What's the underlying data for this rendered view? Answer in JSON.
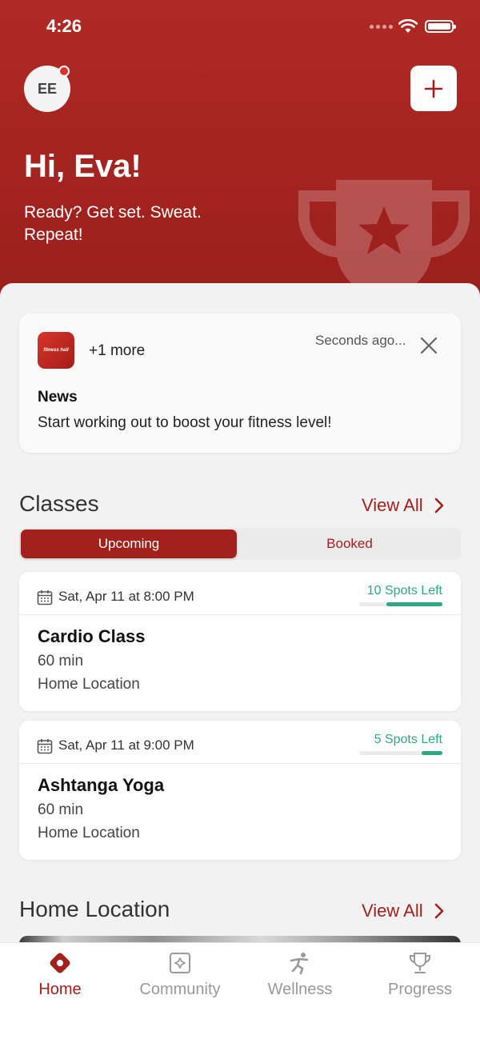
{
  "status_bar": {
    "time": "4:26"
  },
  "header": {
    "avatar_initials": "EE",
    "greeting": "Hi, Eva!",
    "tagline": "Ready? Get set. Sweat. Repeat!",
    "add_icon": "plus-icon",
    "decoration_icon": "trophy-icon"
  },
  "notification": {
    "app_icon_text": "fitness hall",
    "more": "+1 more",
    "timestamp": "Seconds ago...",
    "title": "News",
    "body": "Start working out to boost your fitness level!"
  },
  "classes": {
    "title": "Classes",
    "view_all": "View All",
    "tabs": [
      {
        "label": "Upcoming",
        "active": true
      },
      {
        "label": "Booked",
        "active": false
      }
    ],
    "items": [
      {
        "date": "Sat, Apr 11 at 8:00 PM",
        "spots": "10 Spots Left",
        "spots_fraction": 0.67,
        "name": "Cardio Class",
        "duration": "60 min",
        "location": "Home Location"
      },
      {
        "date": "Sat, Apr 11 at 9:00 PM",
        "spots": "5 Spots Left",
        "spots_fraction": 0.25,
        "name": "Ashtanga Yoga",
        "duration": "60 min",
        "location": "Home Location"
      }
    ]
  },
  "home_location": {
    "title": "Home Location",
    "view_all": "View All"
  },
  "tabbar": [
    {
      "label": "Home",
      "icon": "home-icon",
      "active": true
    },
    {
      "label": "Community",
      "icon": "community-icon",
      "active": false
    },
    {
      "label": "Wellness",
      "icon": "wellness-icon",
      "active": false
    },
    {
      "label": "Progress",
      "icon": "trophy-icon",
      "active": false
    }
  ],
  "colors": {
    "brand": "#a3211d",
    "accent_green": "#2ea883"
  }
}
